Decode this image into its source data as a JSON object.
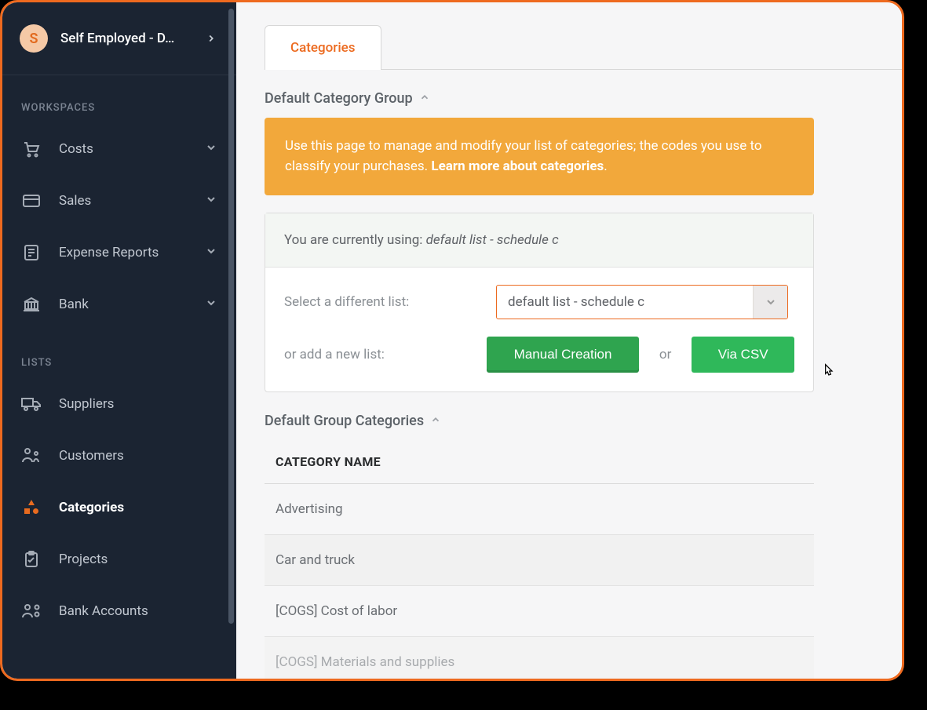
{
  "workspace": {
    "avatar_letter": "S",
    "title": "Self Employed - D…"
  },
  "sidebar": {
    "sections": {
      "workspaces_label": "WORKSPACES",
      "lists_label": "LISTS"
    },
    "items": {
      "costs": "Costs",
      "sales": "Sales",
      "expense_reports": "Expense Reports",
      "bank": "Bank",
      "suppliers": "Suppliers",
      "customers": "Customers",
      "categories": "Categories",
      "projects": "Projects",
      "bank_accounts": "Bank Accounts"
    }
  },
  "tabs": {
    "categories": "Categories"
  },
  "group_heading": "Default Category Group",
  "banner": {
    "text": "Use this page to manage and modify your list of categories; the codes you use to classify your purchases. ",
    "learn": "Learn more about categories",
    "dot": "."
  },
  "panel": {
    "using_prefix": "You are currently using: ",
    "using_value": "default list - schedule c",
    "select_label": "Select a different list:",
    "select_value": "default list - schedule c",
    "add_label": "or add a new list:",
    "manual_btn": "Manual Creation",
    "or": "or",
    "csv_btn": "Via CSV"
  },
  "categories_heading": "Default Group Categories",
  "table": {
    "header": "CATEGORY NAME",
    "rows": [
      "Advertising",
      "Car and truck",
      "[COGS] Cost of labor",
      "[COGS] Materials and supplies"
    ]
  }
}
